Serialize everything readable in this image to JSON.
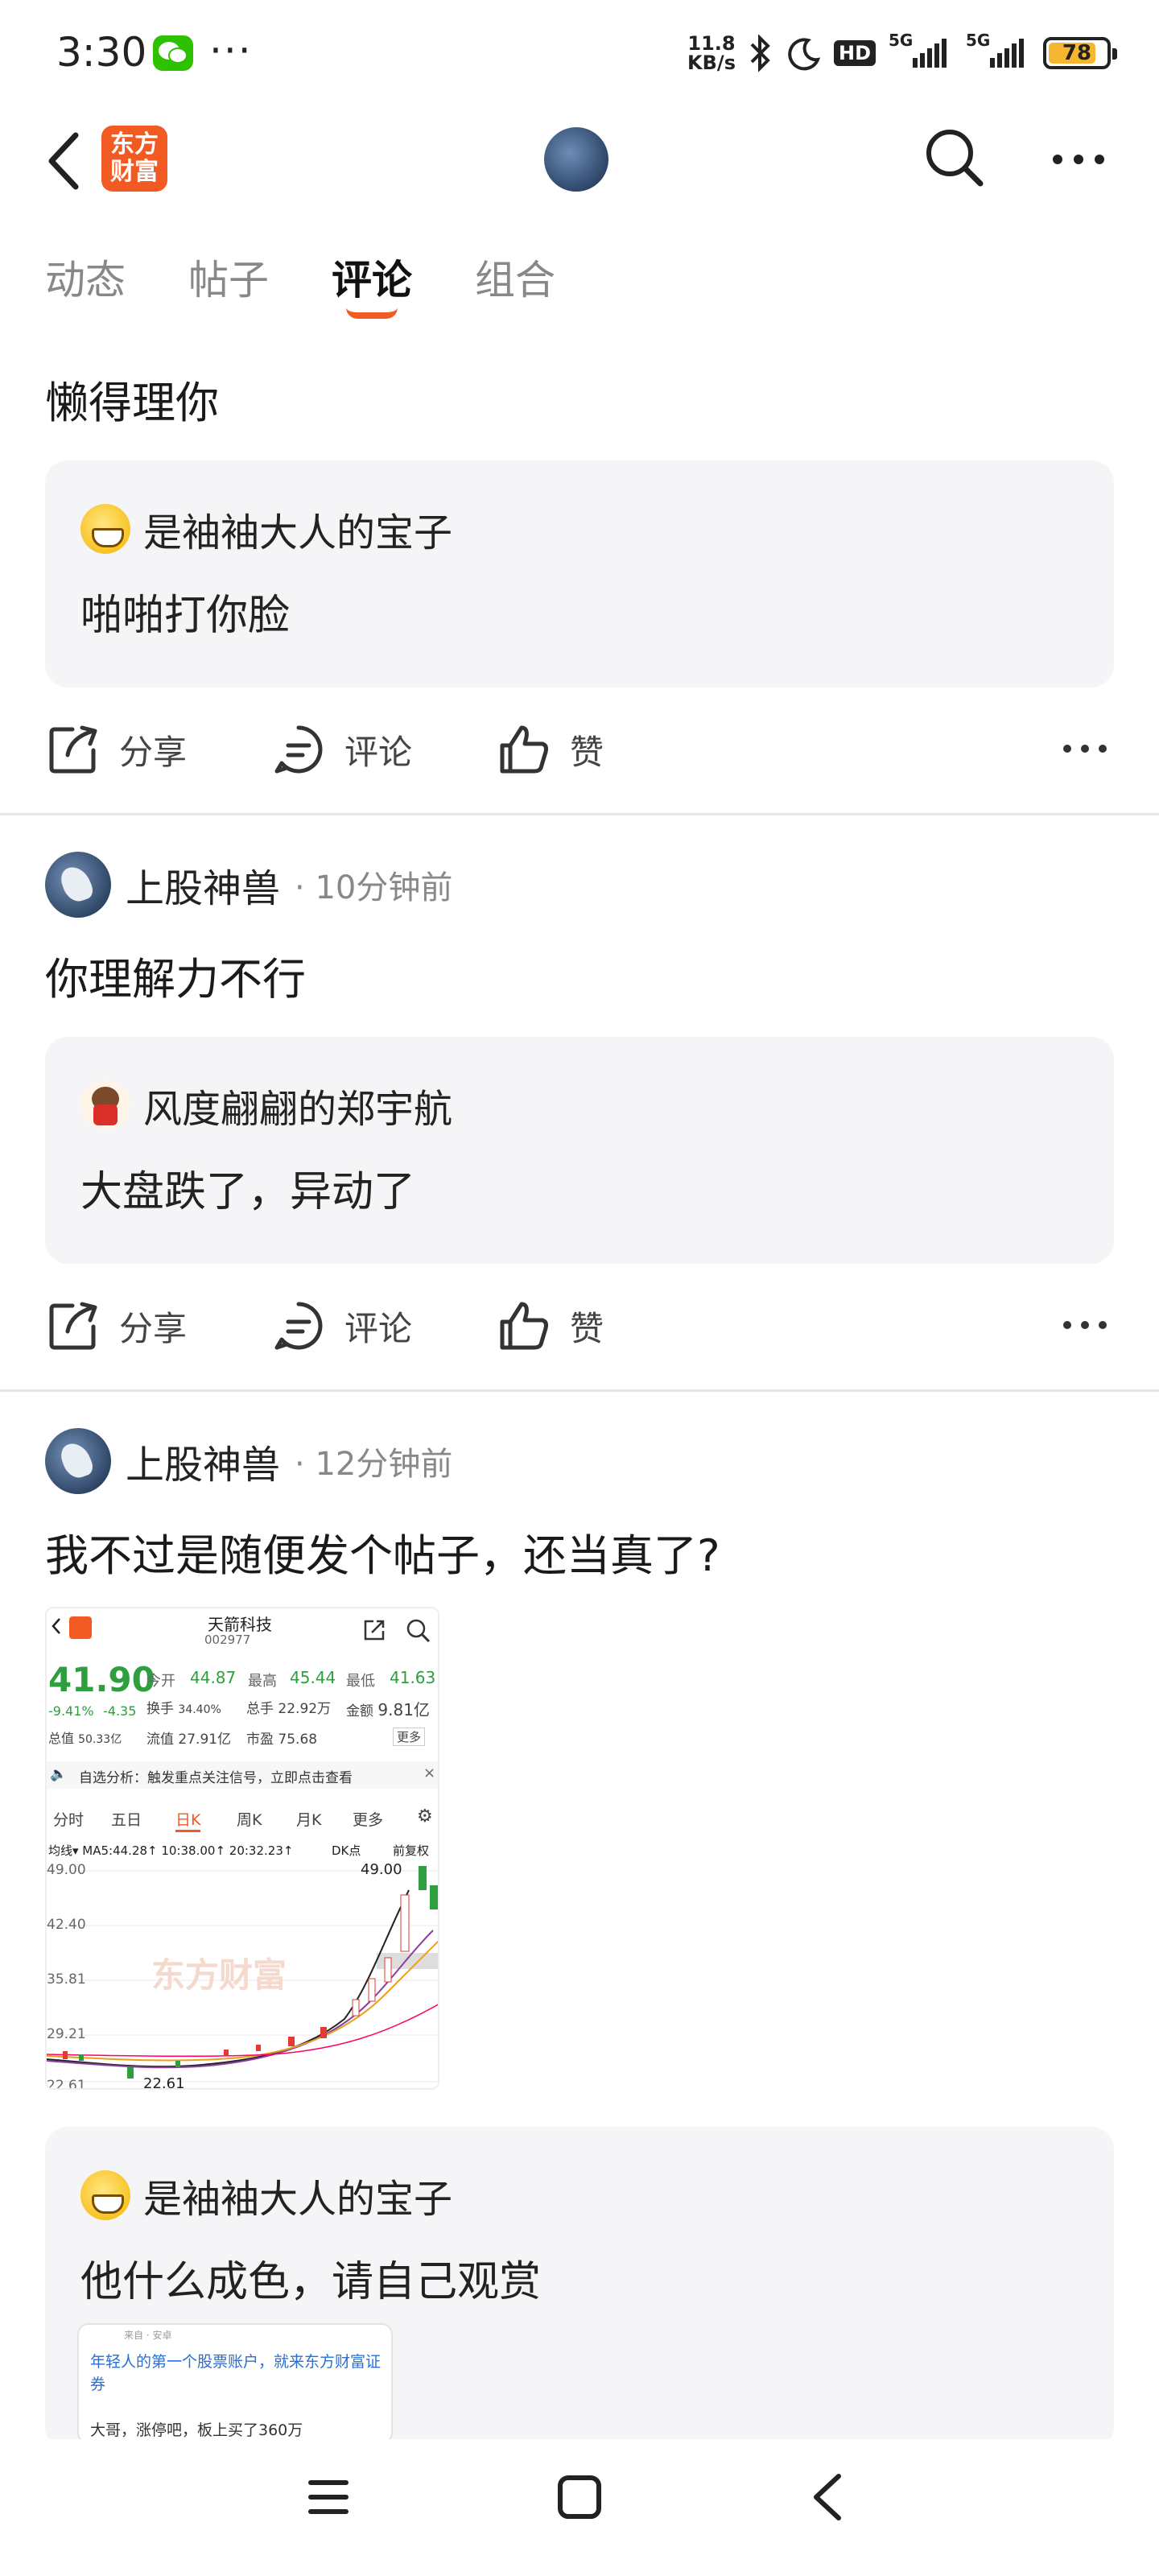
{
  "status": {
    "time": "3:30",
    "speed_value": "11.8",
    "speed_unit": "KB/s",
    "hd": "HD",
    "net1": "5G",
    "net2": "5G",
    "battery": "78"
  },
  "nav": {
    "logo_line1": "东方",
    "logo_line2": "财富"
  },
  "tabs": [
    {
      "label": "动态"
    },
    {
      "label": "帖子"
    },
    {
      "label": "评论"
    },
    {
      "label": "组合"
    }
  ],
  "actions": {
    "share": "分享",
    "comment": "评论",
    "like": "赞"
  },
  "posts": [
    {
      "text": "懒得理你",
      "quote": {
        "author": "是袖袖大人的宝子",
        "text": "啪啪打你脸"
      }
    },
    {
      "author": "上股神兽",
      "time": "· 10分钟前",
      "text": "你理解力不行",
      "quote": {
        "author": "风度翩翩的郑宇航",
        "text": "大盘跌了，异动了"
      }
    },
    {
      "author": "上股神兽",
      "time": "· 12分钟前",
      "text": "我不过是随便发个帖子，还当真了?",
      "quote": {
        "author": "是袖袖大人的宝子",
        "text": "他什么成色，请自己观赏"
      }
    }
  ],
  "stock_shot": {
    "name": "天箭科技",
    "code": "002977",
    "price": "41.90",
    "chg_pct": "-9.41%",
    "chg": "-4.35",
    "open_label": "今开",
    "open": "44.87",
    "high_label": "最高",
    "high": "45.44",
    "low_label": "最低",
    "low": "41.63",
    "turnover_label": "换手",
    "turnover": "34.40%",
    "vol_label": "总手",
    "vol": "22.92万",
    "amt_label": "金额",
    "amt": "9.81亿",
    "cap_label": "总值",
    "cap": "50.33亿",
    "float_label": "流值",
    "float": "27.91亿",
    "pe_label": "市盈",
    "pe": "75.68",
    "more": "更多",
    "notice": "自选分析：触发重点关注信号，立即点击查看",
    "periods": [
      "分时",
      "五日",
      "日K",
      "周K",
      "月K",
      "更多"
    ],
    "ma_row": "均线▾  MA5:44.28↑ 10:38.00↑ 20:32.23↑",
    "dk": "DK点",
    "fq": "前复权",
    "y_ticks": [
      "49.00",
      "42.40",
      "35.81",
      "29.21",
      "22.61"
    ],
    "peak": "49.00",
    "low_mark": "22.61",
    "watermark": "东方财富"
  },
  "ad_card": {
    "source": "来自 · 安卓",
    "title": "年轻人的第一个股票账户，就来东方财富证券",
    "text": "大哥，涨停吧，板上买了360万"
  },
  "colors": {
    "brand": "#f15a22",
    "up": "#e53935",
    "down": "#2e9e3f"
  }
}
